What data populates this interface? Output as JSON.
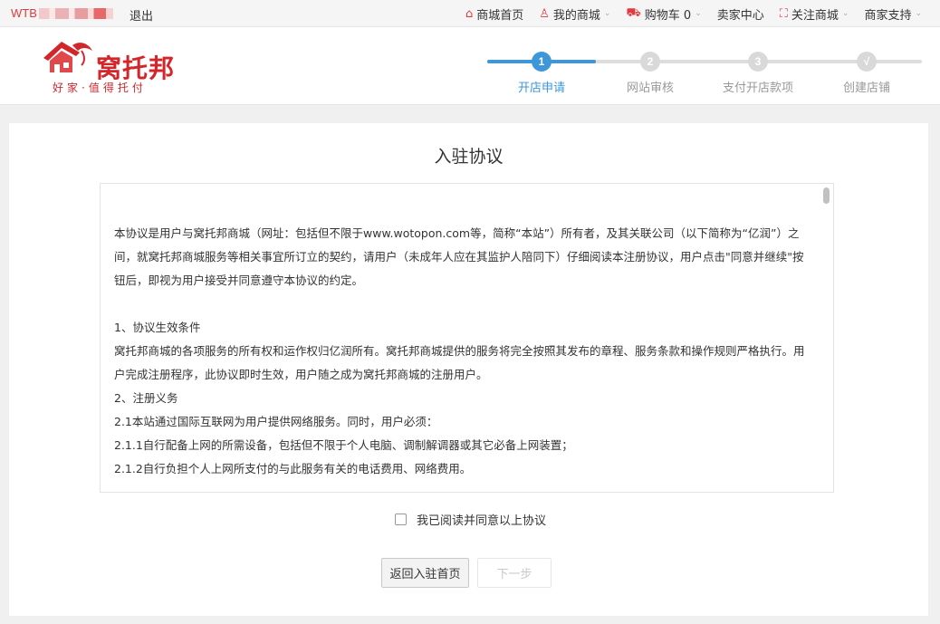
{
  "topbar": {
    "user_prefix": "WTB",
    "logout": "退出",
    "nav": [
      {
        "icon": "home-icon",
        "glyph": "⌂",
        "label": "商城首页",
        "dropdown": false
      },
      {
        "icon": "user-icon",
        "glyph": "♙",
        "label": "我的商城",
        "dropdown": true
      },
      {
        "icon": "cart-icon",
        "glyph": "⛟",
        "label": "购物车 0",
        "dropdown": true
      },
      {
        "icon": "",
        "glyph": "",
        "label": "卖家中心",
        "dropdown": false
      },
      {
        "icon": "follow-icon",
        "glyph": "⛶",
        "label": "关注商城",
        "dropdown": true
      },
      {
        "icon": "",
        "glyph": "",
        "label": "商家支持",
        "dropdown": true
      }
    ]
  },
  "header": {
    "logo_name": "窝托邦",
    "logo_slogan": "好家·值得托付",
    "brand_color": "#d3262a",
    "accent_color": "#3d97d8",
    "progress": 0.25,
    "steps": [
      {
        "num": "1",
        "label": "开店申请",
        "active": true
      },
      {
        "num": "2",
        "label": "网站审核",
        "active": false
      },
      {
        "num": "3",
        "label": "支付开店款项",
        "active": false
      },
      {
        "num": "√",
        "label": "创建店铺",
        "active": false
      }
    ]
  },
  "main": {
    "title": "入驻协议",
    "agreement": {
      "paragraphs": [
        "本协议是用户与窝托邦商城（网址：包括但不限于www.wotopon.com等，简称“本站”）所有者，及其关联公司（以下简称为“亿润”）之间，就窝托邦商城服务等相关事宜所订立的契约，请用户（未成年人应在其监护人陪同下）仔细阅读本注册协议，用户点击\"同意并继续\"按钮后，即视为用户接受并同意遵守本协议的约定。",
        "",
        "1、协议生效条件",
        "窝托邦商城的各项服务的所有权和运作权归亿润所有。窝托邦商城提供的服务将完全按照其发布的章程、服务条款和操作规则严格执行。用户完成注册程序，此协议即时生效，用户随之成为窝托邦商城的注册用户。",
        "2、注册义务",
        "2.1本站通过国际互联网为用户提供网络服务。同时，用户必须：",
        "2.1.1自行配备上网的所需设备，包括但不限于个人电脑、调制解调器或其它必备上网装置；",
        "2.1.2自行负担个人上网所支付的与此服务有关的电话费用、网络费用。"
      ]
    },
    "agree_label": "我已阅读并同意以上协议",
    "back_button": "返回入驻首页",
    "next_button": "下一步"
  }
}
